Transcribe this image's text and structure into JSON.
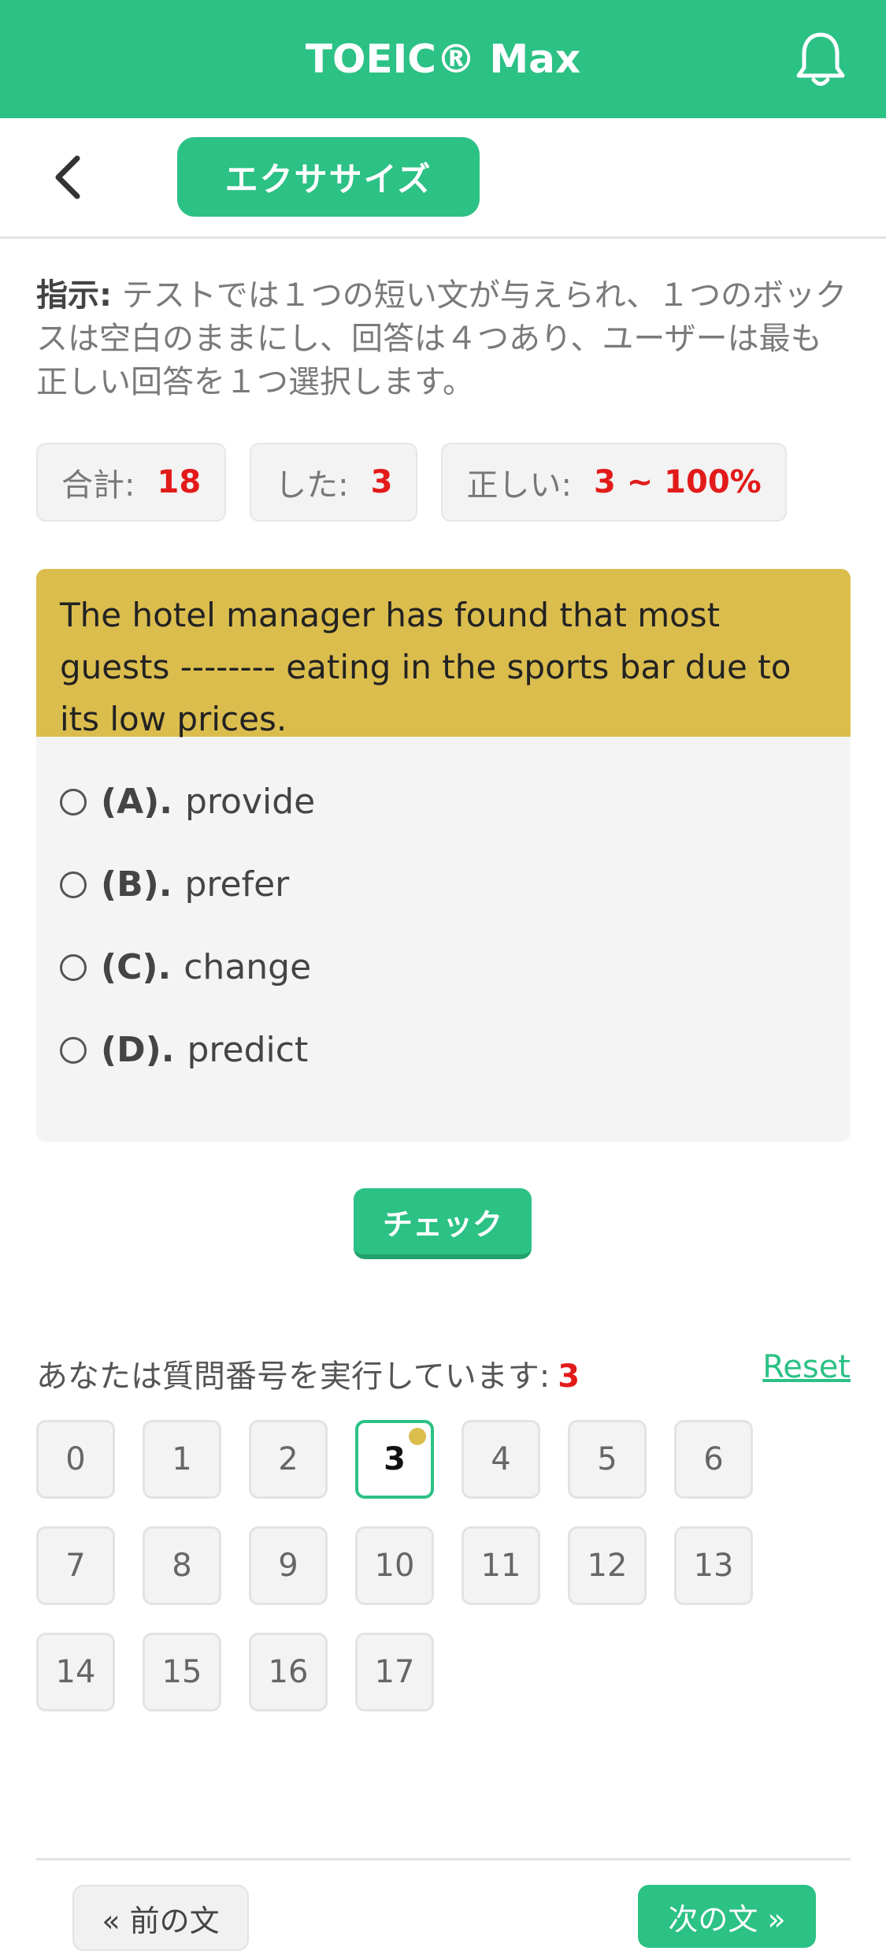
{
  "app": {
    "title": "TOEIC® Max",
    "bell_icon": "bell-icon"
  },
  "tab": {
    "label": "エクササイズ"
  },
  "instruction": {
    "prefix": "指示:",
    "text": " テストでは１つの短い文が与えられ、１つのボックスは空白のままにし、回答は４つあり、ユーザーは最も正しい回答を１つ選択します。"
  },
  "stats": {
    "total_label": "合計:",
    "total_value": "18",
    "done_label": "した:",
    "done_value": "3",
    "correct_label": "正しい:",
    "correct_value": "3 ~ 100%"
  },
  "question": {
    "text": "The hotel manager has found that most guests -------- eating in the sports bar due to its low prices.",
    "options": [
      {
        "letter": "(A).",
        "text": "provide"
      },
      {
        "letter": "(B).",
        "text": "prefer"
      },
      {
        "letter": "(C).",
        "text": "change"
      },
      {
        "letter": "(D).",
        "text": "predict"
      }
    ]
  },
  "check_button": "チェック",
  "progress": {
    "label": "あなたは質問番号を実行しています:",
    "current": "3",
    "reset": "Reset",
    "numbers": [
      "0",
      "1",
      "2",
      "3",
      "4",
      "5",
      "6",
      "7",
      "8",
      "9",
      "10",
      "11",
      "12",
      "13",
      "14",
      "15",
      "16",
      "17"
    ]
  },
  "nav": {
    "prev": "« 前の文",
    "next": "次の文 »"
  },
  "colors": {
    "accent": "#2cc185",
    "highlight": "#dbbd4e",
    "error": "#e21a1a"
  }
}
